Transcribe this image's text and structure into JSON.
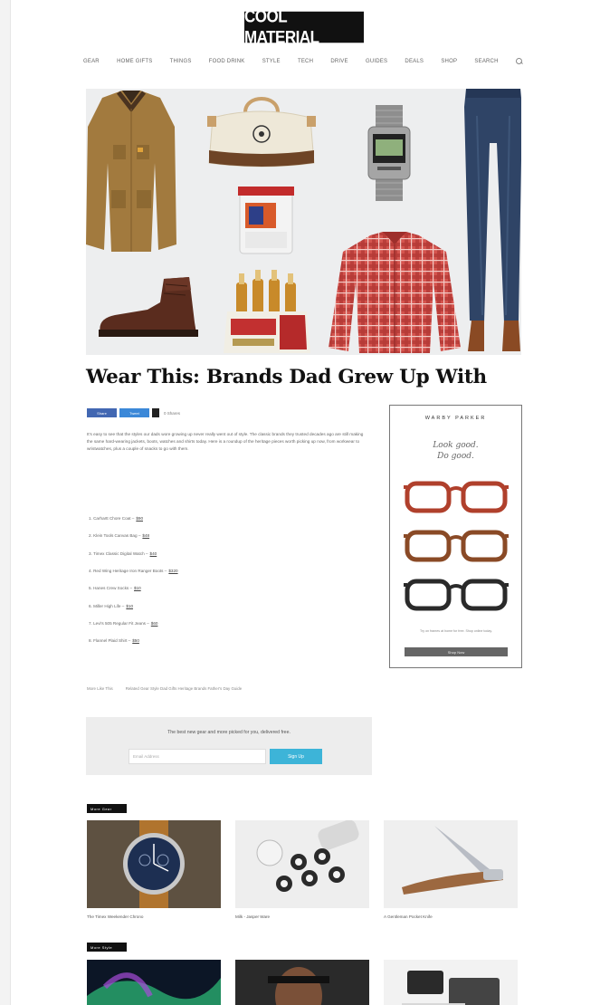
{
  "site": {
    "logo_text": "COOL MATERIAL"
  },
  "nav": {
    "items": [
      "Gear",
      "Home Gifts",
      "Things",
      "Food Drink",
      "Style",
      "Tech",
      "Drive",
      "Guides",
      "Deals",
      "Shop",
      "Search"
    ]
  },
  "article": {
    "title": "Wear This: Brands Dad Grew Up With",
    "share": {
      "facebook_label": "Share",
      "twitter_label": "Tweet",
      "count_label": "0 Shares"
    },
    "body": "It's easy to see that the styles our dads wore growing up never really went out of style. The classic brands they trusted decades ago are still making the same hard-wearing jackets, boots, watches and shirts today. Here is a roundup of the heritage pieces worth picking up now, from workwear to wristwatches, plus a couple of snacks to go with them.",
    "products": [
      {
        "name": "Carhartt Chore Coat",
        "price": "$90"
      },
      {
        "name": "Klein Tools Canvas Bag",
        "price": "$48"
      },
      {
        "name": "Timex Classic Digital Watch",
        "price": "$40"
      },
      {
        "name": "Red Wing Heritage Iron Ranger Boots",
        "price": "$320"
      },
      {
        "name": "Hanes Crew Socks",
        "price": "$10"
      },
      {
        "name": "Miller High Life",
        "price": "$10"
      },
      {
        "name": "Levi's 505 Regular Fit Jeans",
        "price": "$60"
      },
      {
        "name": "Flannel Plaid Shirt",
        "price": "$50"
      }
    ],
    "tags": [
      "More Like This",
      "Related Gear Style Dad Gifts Heritage Brands Father's Day Guide"
    ]
  },
  "ad": {
    "brand": "WARBY PARKER",
    "tagline_line1": "Look good.",
    "tagline_line2": "Do good.",
    "fine_print": "Try on frames at home for free. Shop online today.",
    "cta": "Shop Now"
  },
  "newsletter": {
    "text": "The best new gear and more picked for you, delivered free.",
    "placeholder": "Email Address",
    "button": "Sign Up"
  },
  "sections": [
    {
      "label": "More Gear",
      "cards": [
        {
          "caption": "The Timex Weekender Chrono"
        },
        {
          "caption": "Milk - Jasper Ware"
        },
        {
          "caption": "A Gentleman Pocket Knife"
        }
      ]
    },
    {
      "label": "More Style",
      "cards": [
        {
          "caption": ""
        },
        {
          "caption": ""
        },
        {
          "caption": ""
        }
      ]
    }
  ],
  "colors": {
    "facebook": "#4267b2",
    "twitter": "#3b88d8",
    "signup_button": "#3db4d8",
    "hero_background": "#edeeef"
  }
}
